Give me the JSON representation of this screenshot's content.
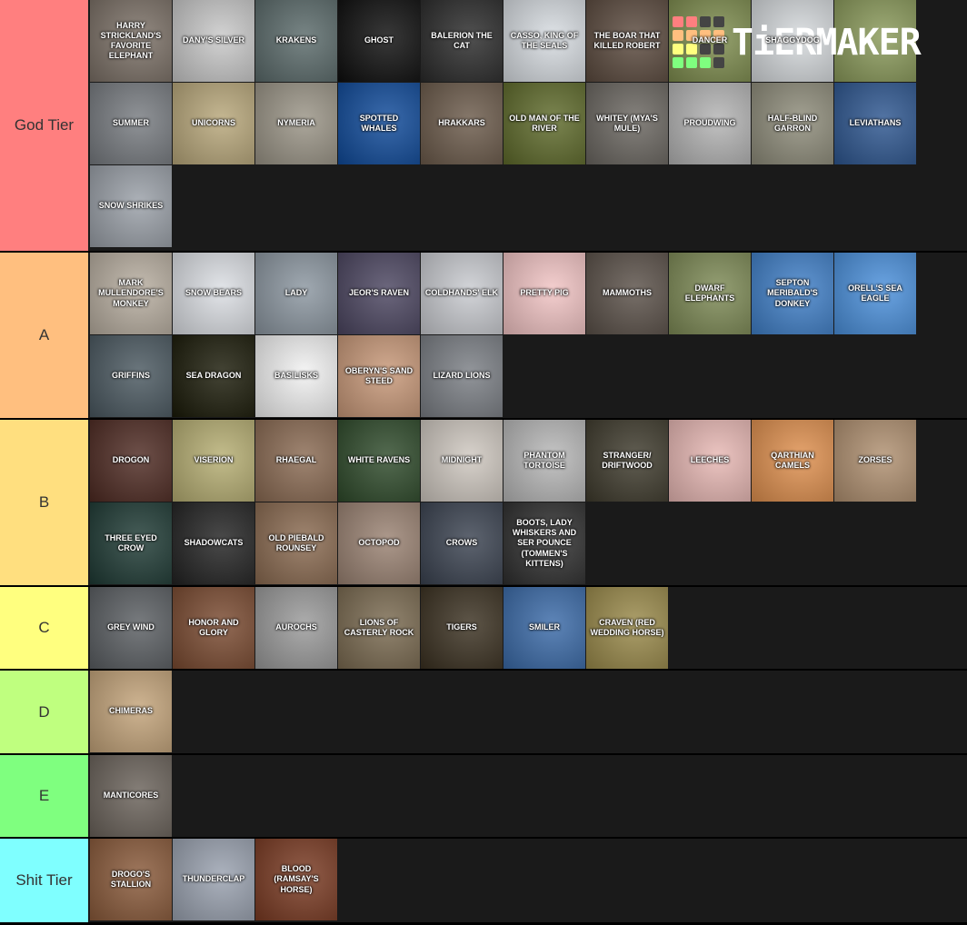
{
  "tiers": [
    {
      "label": "God Tier",
      "color": "#ff7f7f",
      "rows": 3,
      "items": [
        {
          "label": "HARRY STRICKLAND'S FAVORITE ELEPHANT",
          "bg": "#7b7066"
        },
        {
          "label": "DANY'S SILVER",
          "bg": "#c9c9c9"
        },
        {
          "label": "KRAKENS",
          "bg": "#5a6a6a"
        },
        {
          "label": "GHOST",
          "bg": "#0d0d0d"
        },
        {
          "label": "BALERION THE CAT",
          "bg": "#2a2a2a"
        },
        {
          "label": "CASSO, KING OF THE SEALS",
          "bg": "#d8dde2"
        },
        {
          "label": "THE BOAR THAT KILLED ROBERT",
          "bg": "#5b4a3e"
        },
        {
          "label": "DANCER",
          "bg": "#7e8d4e"
        },
        {
          "label": "SHAGGYDOG",
          "bg": "#d6dadd"
        },
        {
          "label": "",
          "bg": "#8a9a5a"
        },
        {
          "label": "SUMMER",
          "bg": "#777b80"
        },
        {
          "label": "UNICORNS",
          "bg": "#b8a77a"
        },
        {
          "label": "NYMERIA",
          "bg": "#9a9486"
        },
        {
          "label": "SPOTTED WHALES",
          "bg": "#0f4a9a"
        },
        {
          "label": "HRAKKARS",
          "bg": "#6b5a4a"
        },
        {
          "label": "OLD MAN OF THE RIVER",
          "bg": "#5e6a2a"
        },
        {
          "label": "WHITEY (MYA'S MULE)",
          "bg": "#6a6660"
        },
        {
          "label": "PROUDWING",
          "bg": "#b4b4b4"
        },
        {
          "label": "HALF-BLIND GARRON",
          "bg": "#8e8c7a"
        },
        {
          "label": "LEVIATHANS",
          "bg": "#2d5690"
        },
        {
          "label": "SNOW SHRIKES",
          "bg": "#9aa0a8"
        }
      ]
    },
    {
      "label": "A",
      "color": "#ffbf7f",
      "rows": 2,
      "items": [
        {
          "label": "MARK MULLENDORE'S MONKEY",
          "bg": "#b8aea0"
        },
        {
          "label": "SNOW BEARS",
          "bg": "#dcdfe4"
        },
        {
          "label": "LADY",
          "bg": "#8b96a0"
        },
        {
          "label": "JEOR'S RAVEN",
          "bg": "#4b4560"
        },
        {
          "label": "COLDHANDS' ELK",
          "bg": "#c9cbd0"
        },
        {
          "label": "PRETTY PIG",
          "bg": "#f2c4c4"
        },
        {
          "label": "MAMMOTHS",
          "bg": "#5a5048"
        },
        {
          "label": "DWARF ELEPHANTS",
          "bg": "#7d8a55"
        },
        {
          "label": "SEPTON MERIBALD'S DONKEY",
          "bg": "#3f7fc8"
        },
        {
          "label": "ORELL'S SEA EAGLE",
          "bg": "#4a90dc"
        },
        {
          "label": "GRIFFINS",
          "bg": "#4a5860"
        },
        {
          "label": "SEA DRAGON",
          "bg": "#1a1a08"
        },
        {
          "label": "BASILISKS",
          "bg": "#f2f2f2"
        },
        {
          "label": "OBERYN'S SAND STEED",
          "bg": "#c89878"
        },
        {
          "label": "LIZARD LIONS",
          "bg": "#7a7e84"
        }
      ]
    },
    {
      "label": "B",
      "color": "#ffdf7f",
      "rows": 2,
      "items": [
        {
          "label": "DROGON",
          "bg": "#4e2a22"
        },
        {
          "label": "VISERION",
          "bg": "#b6ae72"
        },
        {
          "label": "RHAEGAL",
          "bg": "#8a6a52"
        },
        {
          "label": "WHITE RAVENS",
          "bg": "#2e4a2a"
        },
        {
          "label": "MIDNIGHT",
          "bg": "#cfc8c0"
        },
        {
          "label": "PHANTOM TORTOISE",
          "bg": "#b8b8b8"
        },
        {
          "label": "STRANGER/ DRIFTWOOD",
          "bg": "#3e3a2c"
        },
        {
          "label": "LEECHES",
          "bg": "#e8b8b4"
        },
        {
          "label": "QARTHIAN CAMELS",
          "bg": "#e0904e"
        },
        {
          "label": "ZORSES",
          "bg": "#b09070"
        },
        {
          "label": "THREE EYED CROW",
          "bg": "#1e3a34"
        },
        {
          "label": "SHADOWCATS",
          "bg": "#222222"
        },
        {
          "label": "OLD PIEBALD ROUNSEY",
          "bg": "#8a6a50"
        },
        {
          "label": "OCTOPOD",
          "bg": "#9a8272"
        },
        {
          "label": "CROWS",
          "bg": "#3a4250"
        },
        {
          "label": "BOOTS, LADY WHISKERS AND SER POUNCE (TOMMEN'S KITTENS)",
          "bg": "#2e2e2e"
        }
      ]
    },
    {
      "label": "C",
      "color": "#ffff7f",
      "rows": 1,
      "items": [
        {
          "label": "GREY WIND",
          "bg": "#5a5e62"
        },
        {
          "label": "HONOR AND GLORY",
          "bg": "#7a4a30"
        },
        {
          "label": "AUROCHS",
          "bg": "#9a9a9a"
        },
        {
          "label": "LIONS OF CASTERLY ROCK",
          "bg": "#7a6a50"
        },
        {
          "label": "TIGERS",
          "bg": "#3a3020"
        },
        {
          "label": "SMILER",
          "bg": "#3a6aa8"
        },
        {
          "label": "CRAVEN (RED WEDDING HORSE)",
          "bg": "#9a8a4a"
        }
      ]
    },
    {
      "label": "D",
      "color": "#bfff7f",
      "rows": 1,
      "items": [
        {
          "label": "CHIMERAS",
          "bg": "#c4a47a"
        }
      ]
    },
    {
      "label": "E",
      "color": "#7fff7f",
      "rows": 1,
      "items": [
        {
          "label": "MANTICORES",
          "bg": "#6a625a"
        }
      ]
    },
    {
      "label": "Shit Tier",
      "color": "#7fffff",
      "rows": 1,
      "items": [
        {
          "label": "DROGO'S STALLION",
          "bg": "#8a5a3a"
        },
        {
          "label": "THUNDERCLAP",
          "bg": "#9aa2b0"
        },
        {
          "label": "BLOOD (RAMSAY'S HORSE)",
          "bg": "#7a3a22"
        }
      ]
    }
  ],
  "watermark": {
    "text": "TiERMAKER",
    "colors": [
      "#ff7f7f",
      "#ff7f7f",
      "#444444",
      "#444444",
      "#ffbf7f",
      "#ffbf7f",
      "#ffbf7f",
      "#ffbf7f",
      "#ffff7f",
      "#ffff7f",
      "#444444",
      "#444444",
      "#7fff7f",
      "#7fff7f",
      "#7fff7f",
      "#444444"
    ]
  }
}
